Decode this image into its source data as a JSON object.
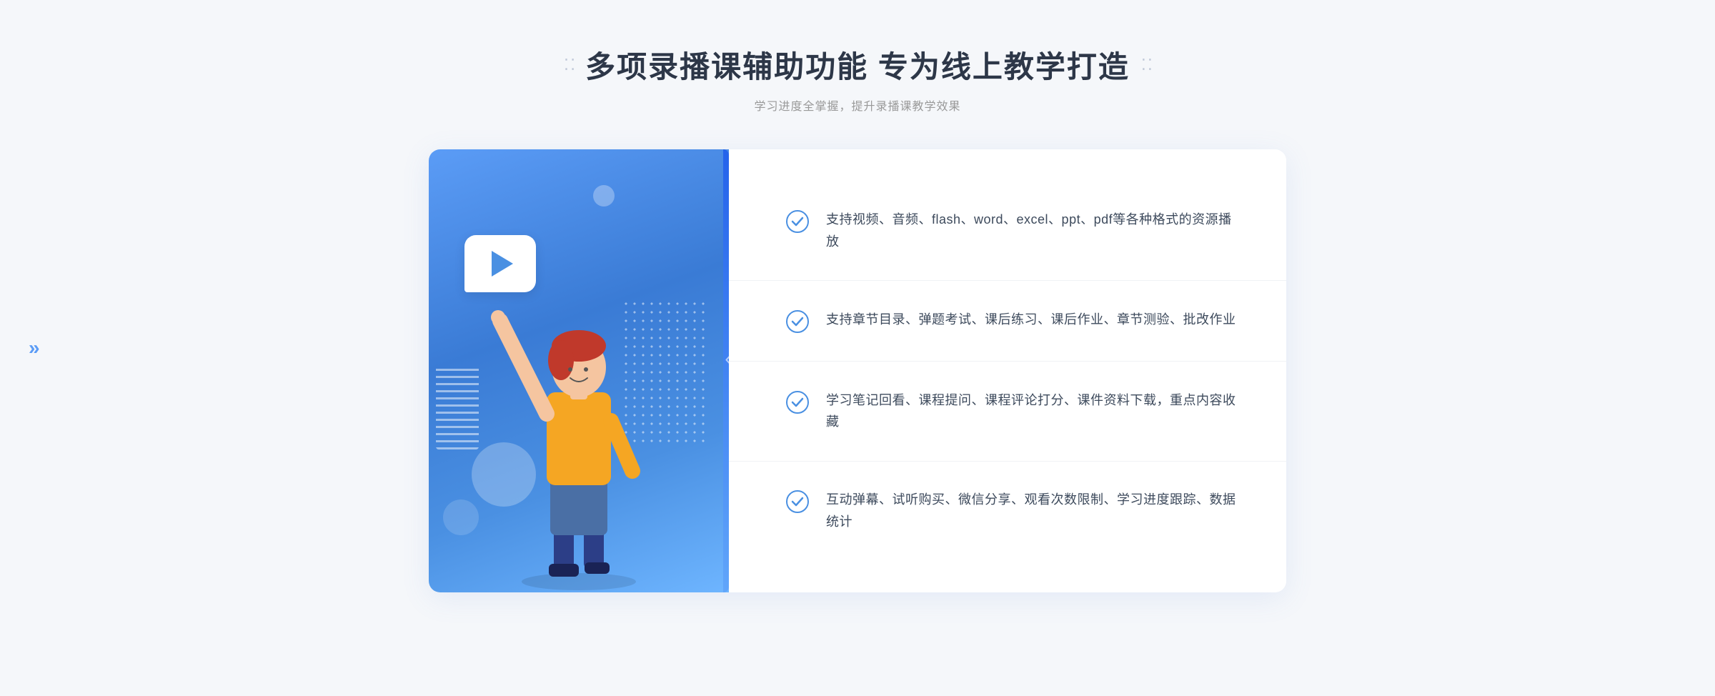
{
  "header": {
    "title": "多项录播课辅助功能 专为线上教学打造",
    "subtitle": "学习进度全掌握，提升录播课教学效果",
    "decorator_left": "⁙",
    "decorator_right": "⁙"
  },
  "features": [
    {
      "id": 1,
      "text": "支持视频、音频、flash、word、excel、ppt、pdf等各种格式的资源播放"
    },
    {
      "id": 2,
      "text": "支持章节目录、弹题考试、课后练习、课后作业、章节测验、批改作业"
    },
    {
      "id": 3,
      "text": "学习笔记回看、课程提问、课程评论打分、课件资料下载，重点内容收藏"
    },
    {
      "id": 4,
      "text": "互动弹幕、试听购买、微信分享、观看次数限制、学习进度跟踪、数据统计"
    }
  ],
  "colors": {
    "accent": "#4a90e2",
    "check": "#4a90e2",
    "title": "#2d3748",
    "text": "#3d4a5c",
    "subtitle": "#999999"
  }
}
